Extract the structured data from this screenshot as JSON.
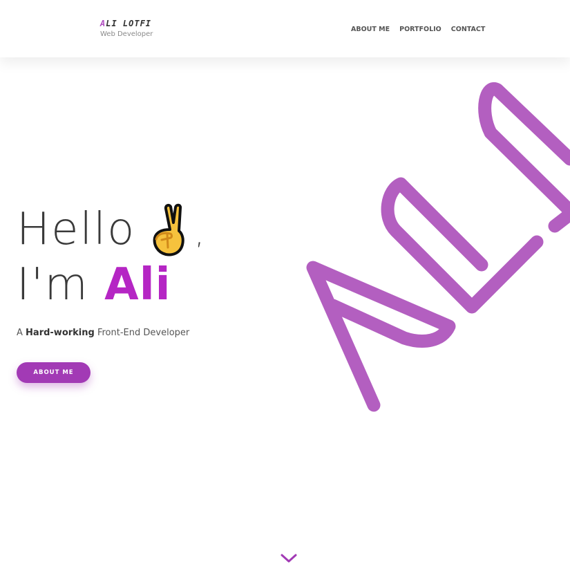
{
  "header": {
    "brand_first": "A",
    "brand_rest": "LI LOTFI",
    "brand_subtitle": "Web Developer",
    "nav": [
      {
        "label": "ABOUT ME"
      },
      {
        "label": "PORTFOLIO"
      },
      {
        "label": "CONTACT"
      }
    ]
  },
  "hero": {
    "hello": "Hello",
    "emoji_icon": "victory-hand-icon",
    "comma": ",",
    "im": "I'm",
    "name": "Ali",
    "tagline_prefix": "A",
    "tagline_bold": "Hard-working",
    "tagline_suffix": "Front-End Developer",
    "cta_label": "ABOUT ME",
    "logo_icon": "ali-signature-logo",
    "scroll_icon": "chevron-down-icon"
  },
  "colors": {
    "accent": "#b526c4",
    "logo": "#b35fc0",
    "button": "#a23ab5",
    "text": "#333333"
  }
}
